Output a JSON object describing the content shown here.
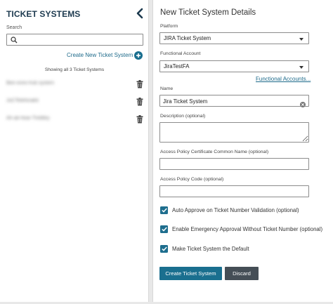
{
  "left": {
    "title": "TICKET SYSTEMS",
    "search_label": "Search",
    "search_value": "",
    "create_link": "Create New Ticket System",
    "showing_text": "Showing all 3 Ticket Systems",
    "items": [
      {
        "name": "Bee-ones-hub system"
      },
      {
        "name": "JoCTelefonakti"
      },
      {
        "name": "Ah-ak-hear-Treblley"
      }
    ]
  },
  "right": {
    "title": "New Ticket System Details",
    "platform_label": "Platform",
    "platform_value": "JIRA Ticket System",
    "functional_account_label": "Functional Account",
    "functional_account_value": "JiraTestFA",
    "functional_accounts_link": "Functional Accounts...",
    "name_label": "Name",
    "name_value": "Jira Ticket System",
    "description_label": "Description (optional)",
    "description_value": "",
    "cert_label": "Access Policy Certificate Common Name (optional)",
    "cert_value": "",
    "policy_code_label": "Access Policy Code (optional)",
    "policy_code_value": "",
    "checkboxes": [
      {
        "label": "Auto Approve on Ticket Number Validation (optional)",
        "checked": true
      },
      {
        "label": "Enable Emergency Approval Without Ticket Number (optional)",
        "checked": true
      },
      {
        "label": "Make Ticket System the Default",
        "checked": true
      }
    ],
    "create_button": "Create Ticket System",
    "discard_button": "Discard"
  },
  "colors": {
    "accent": "#1a6f8f",
    "title_text": "#1d3a4f",
    "secondary_button": "#454e56"
  }
}
